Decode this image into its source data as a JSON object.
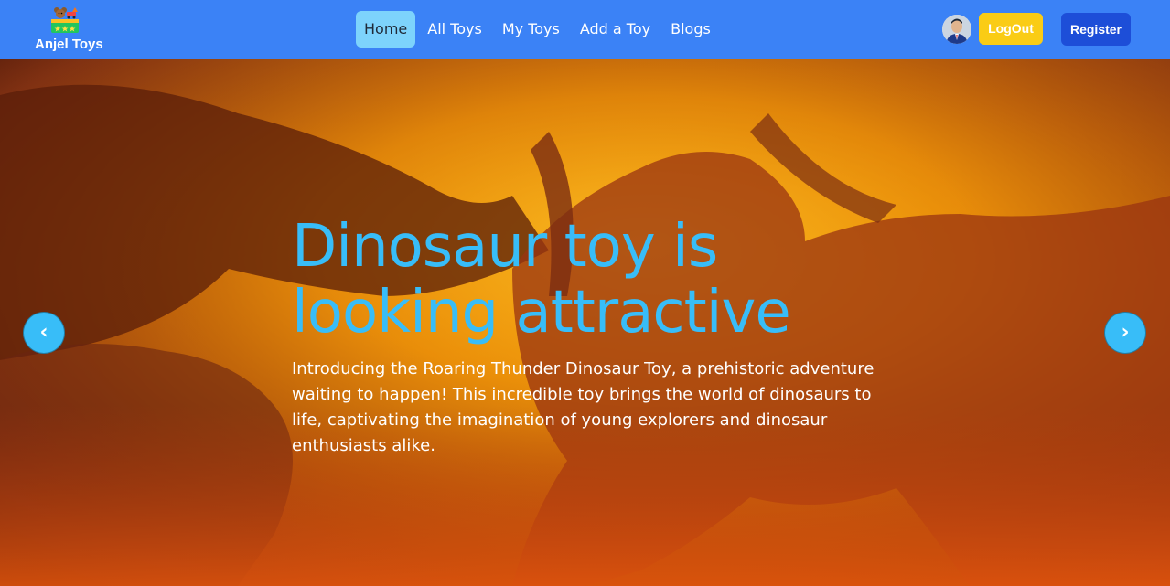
{
  "brand": {
    "name": "Anjel Toys",
    "logo_icon": "toy-box-logo-icon"
  },
  "nav": {
    "items": [
      {
        "label": "Home",
        "active": true
      },
      {
        "label": "All Toys",
        "active": false
      },
      {
        "label": "My Toys",
        "active": false
      },
      {
        "label": "Add a Toy",
        "active": false
      },
      {
        "label": "Blogs",
        "active": false
      }
    ]
  },
  "user": {
    "avatar_icon": "user-avatar"
  },
  "buttons": {
    "logout_label": "LogOut",
    "register_label": "Register"
  },
  "hero": {
    "title": "Dinosaur toy is looking attractive",
    "description": "Introducing the Roaring Thunder Dinosaur Toy, a prehistoric adventure waiting to happen! This incredible toy brings the world of dinosaurs to life, captivating the imagination of young explorers and dinosaur enthusiasts alike.",
    "prev_glyph": "‹",
    "next_glyph": "›"
  },
  "colors": {
    "navbar": "#3b82f6",
    "active_tab": "#7dd3fc",
    "logout": "#facc15",
    "register": "#1d4ed8",
    "accent": "#38bdf8"
  }
}
